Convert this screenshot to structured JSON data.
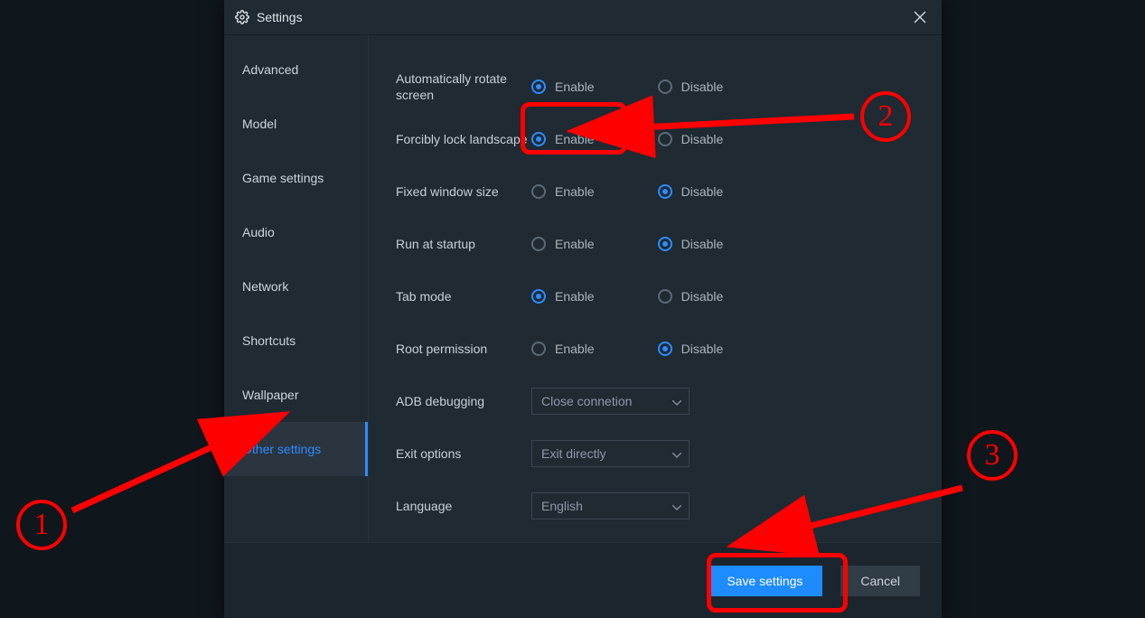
{
  "window": {
    "title": "Settings"
  },
  "sidebar": {
    "items": [
      {
        "label": "Advanced"
      },
      {
        "label": "Model"
      },
      {
        "label": "Game settings"
      },
      {
        "label": "Audio"
      },
      {
        "label": "Network"
      },
      {
        "label": "Shortcuts"
      },
      {
        "label": "Wallpaper"
      },
      {
        "label": "Other settings"
      }
    ],
    "activeIndex": 7
  },
  "options": {
    "enableLabel": "Enable",
    "disableLabel": "Disable",
    "rows": [
      {
        "label": "Automatically rotate screen",
        "value": "enable"
      },
      {
        "label": "Forcibly lock landscape",
        "value": "enable"
      },
      {
        "label": "Fixed window size",
        "value": "disable"
      },
      {
        "label": "Run at startup",
        "value": "disable"
      },
      {
        "label": "Tab mode",
        "value": "enable"
      },
      {
        "label": "Root permission",
        "value": "disable"
      }
    ],
    "selects": [
      {
        "label": "ADB debugging",
        "value": "Close connetion"
      },
      {
        "label": "Exit options",
        "value": "Exit directly"
      },
      {
        "label": "Language",
        "value": "English"
      }
    ]
  },
  "footer": {
    "save": "Save settings",
    "cancel": "Cancel"
  },
  "annotations": {
    "n1": "1",
    "n2": "2",
    "n3": "3"
  }
}
